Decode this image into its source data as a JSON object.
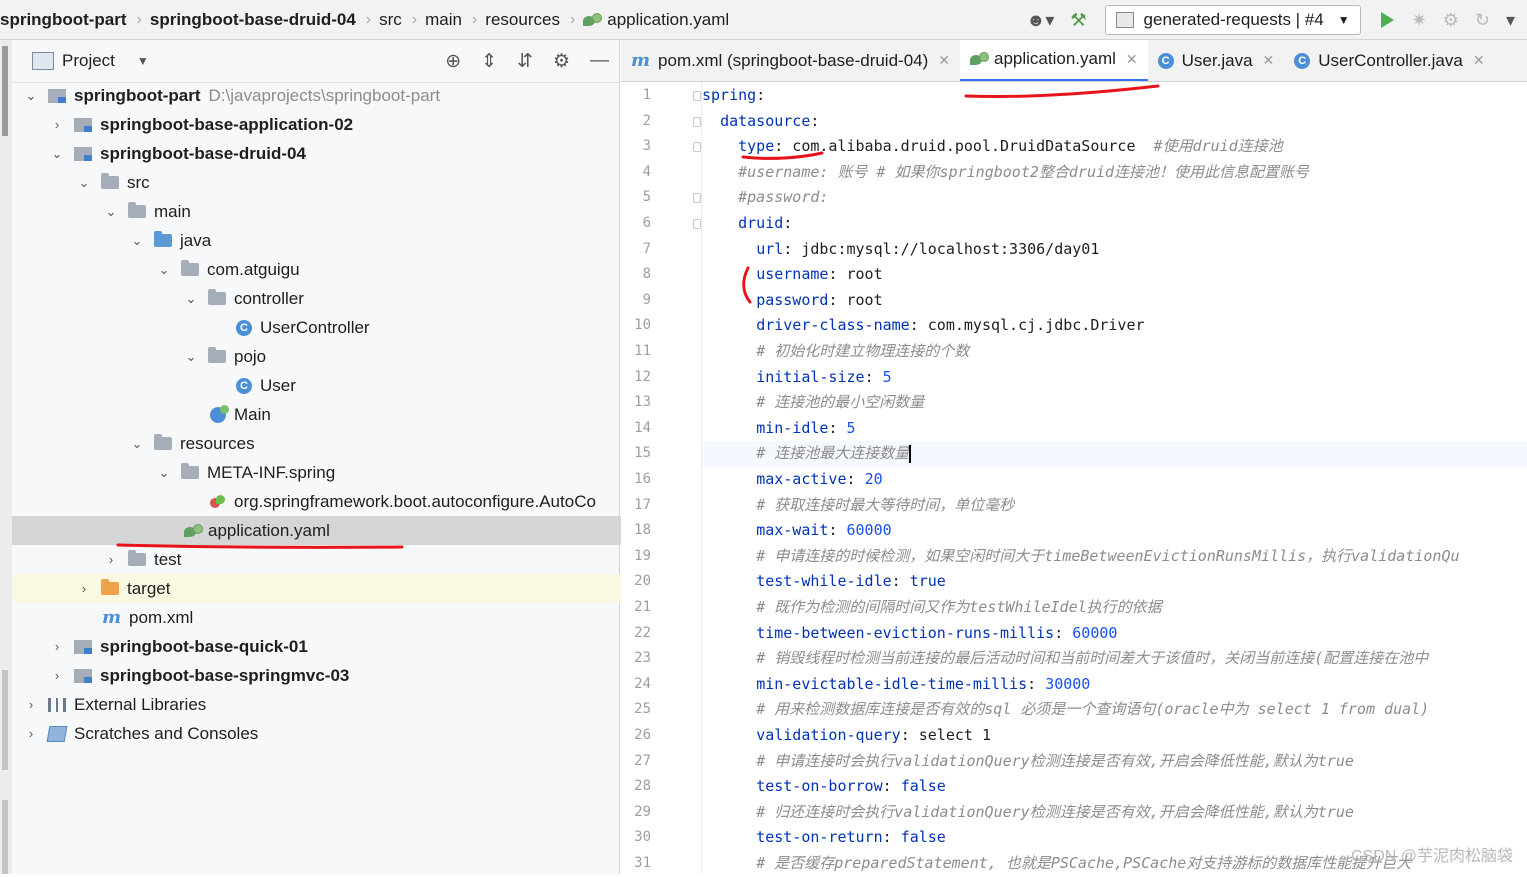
{
  "breadcrumb": [
    "springboot-part",
    "springboot-base-druid-04",
    "src",
    "main",
    "resources",
    "application.yaml"
  ],
  "run_config": {
    "label": "generated-requests | #4"
  },
  "project_panel": {
    "title": "Project",
    "tree": [
      {
        "label": "springboot-part",
        "hint": "D:\\javaprojects\\springboot-part",
        "icon": "module"
      },
      {
        "label": "springboot-base-application-02",
        "icon": "module"
      },
      {
        "label": "springboot-base-druid-04",
        "icon": "module"
      },
      {
        "label": "src",
        "icon": "folder"
      },
      {
        "label": "main",
        "icon": "folder"
      },
      {
        "label": "java",
        "icon": "folder-blue"
      },
      {
        "label": "com.atguigu",
        "icon": "package"
      },
      {
        "label": "controller",
        "icon": "package"
      },
      {
        "label": "UserController",
        "icon": "class"
      },
      {
        "label": "pojo",
        "icon": "package"
      },
      {
        "label": "User",
        "icon": "class"
      },
      {
        "label": "Main",
        "icon": "main-class"
      },
      {
        "label": "resources",
        "icon": "folder-resources"
      },
      {
        "label": "META-INF.spring",
        "icon": "folder"
      },
      {
        "label": "org.springframework.boot.autoconfigure.AutoCo",
        "icon": "spring-file"
      },
      {
        "label": "application.yaml",
        "icon": "yaml-file"
      },
      {
        "label": "test",
        "icon": "folder"
      },
      {
        "label": "target",
        "icon": "folder-orange"
      },
      {
        "label": "pom.xml",
        "icon": "maven-file"
      },
      {
        "label": "springboot-base-quick-01",
        "icon": "module"
      },
      {
        "label": "springboot-base-springmvc-03",
        "icon": "module"
      },
      {
        "label": "External Libraries",
        "icon": "libraries"
      },
      {
        "label": "Scratches and Consoles",
        "icon": "scratches"
      }
    ]
  },
  "tabs": [
    {
      "label": "pom.xml (springboot-base-druid-04)",
      "icon": "maven-icon",
      "active": false
    },
    {
      "label": "application.yaml",
      "icon": "yaml-icon",
      "active": true
    },
    {
      "label": "User.java",
      "icon": "class-icon",
      "active": false
    },
    {
      "label": "UserController.java",
      "icon": "class-icon",
      "active": false
    }
  ],
  "editor": {
    "current_line": 15,
    "lines": [
      {
        "n": "1",
        "parts": [
          [
            "key",
            "spring"
          ],
          [
            "plain",
            ":"
          ]
        ]
      },
      {
        "n": "2",
        "parts": [
          [
            "plain",
            "  "
          ],
          [
            "key",
            "datasource"
          ],
          [
            "plain",
            ":"
          ]
        ]
      },
      {
        "n": "3",
        "parts": [
          [
            "plain",
            "    "
          ],
          [
            "key",
            "type"
          ],
          [
            "plain",
            ": com.alibaba.druid.pool.DruidDataSource  "
          ],
          [
            "cmt",
            "#使用druid连接池"
          ]
        ]
      },
      {
        "n": "4",
        "parts": [
          [
            "plain",
            "    "
          ],
          [
            "cmt",
            "#username: 账号 # 如果你springboot2整合druid连接池！使用此信息配置账号"
          ]
        ]
      },
      {
        "n": "5",
        "parts": [
          [
            "plain",
            "    "
          ],
          [
            "cmt",
            "#password:"
          ]
        ]
      },
      {
        "n": "6",
        "parts": [
          [
            "plain",
            "    "
          ],
          [
            "key",
            "druid"
          ],
          [
            "plain",
            ":"
          ]
        ]
      },
      {
        "n": "7",
        "parts": [
          [
            "plain",
            "      "
          ],
          [
            "key",
            "url"
          ],
          [
            "plain",
            ": jdbc:mysql://localhost:3306/day01"
          ]
        ]
      },
      {
        "n": "8",
        "parts": [
          [
            "plain",
            "      "
          ],
          [
            "key",
            "username"
          ],
          [
            "plain",
            ": root"
          ]
        ]
      },
      {
        "n": "9",
        "parts": [
          [
            "plain",
            "      "
          ],
          [
            "key",
            "password"
          ],
          [
            "plain",
            ": root"
          ]
        ]
      },
      {
        "n": "10",
        "parts": [
          [
            "plain",
            "      "
          ],
          [
            "key",
            "driver-class-name"
          ],
          [
            "plain",
            ": com.mysql.cj.jdbc.Driver"
          ]
        ]
      },
      {
        "n": "11",
        "parts": [
          [
            "plain",
            "      "
          ],
          [
            "cmt",
            "# 初始化时建立物理连接的个数"
          ]
        ]
      },
      {
        "n": "12",
        "parts": [
          [
            "plain",
            "      "
          ],
          [
            "key",
            "initial-size"
          ],
          [
            "plain",
            ": "
          ],
          [
            "num",
            "5"
          ]
        ]
      },
      {
        "n": "13",
        "parts": [
          [
            "plain",
            "      "
          ],
          [
            "cmt",
            "# 连接池的最小空闲数量"
          ]
        ]
      },
      {
        "n": "14",
        "parts": [
          [
            "plain",
            "      "
          ],
          [
            "key",
            "min-idle"
          ],
          [
            "plain",
            ": "
          ],
          [
            "num",
            "5"
          ]
        ]
      },
      {
        "n": "15",
        "parts": [
          [
            "plain",
            "      "
          ],
          [
            "cmt",
            "# 连接池最大连接数量"
          ]
        ]
      },
      {
        "n": "16",
        "parts": [
          [
            "plain",
            "      "
          ],
          [
            "key",
            "max-active"
          ],
          [
            "plain",
            ": "
          ],
          [
            "num",
            "20"
          ]
        ]
      },
      {
        "n": "17",
        "parts": [
          [
            "plain",
            "      "
          ],
          [
            "cmt",
            "# 获取连接时最大等待时间，单位毫秒"
          ]
        ]
      },
      {
        "n": "18",
        "parts": [
          [
            "plain",
            "      "
          ],
          [
            "key",
            "max-wait"
          ],
          [
            "plain",
            ": "
          ],
          [
            "num",
            "60000"
          ]
        ]
      },
      {
        "n": "19",
        "parts": [
          [
            "plain",
            "      "
          ],
          [
            "cmt",
            "# 申请连接的时候检测，如果空闲时间大于timeBetweenEvictionRunsMillis，执行validationQu"
          ]
        ]
      },
      {
        "n": "20",
        "parts": [
          [
            "plain",
            "      "
          ],
          [
            "key",
            "test-while-idle"
          ],
          [
            "plain",
            ": "
          ],
          [
            "bool",
            "true"
          ]
        ]
      },
      {
        "n": "21",
        "parts": [
          [
            "plain",
            "      "
          ],
          [
            "cmt",
            "# 既作为检测的间隔时间又作为testWhileIdel执行的依据"
          ]
        ]
      },
      {
        "n": "22",
        "parts": [
          [
            "plain",
            "      "
          ],
          [
            "key",
            "time-between-eviction-runs-millis"
          ],
          [
            "plain",
            ": "
          ],
          [
            "num",
            "60000"
          ]
        ]
      },
      {
        "n": "23",
        "parts": [
          [
            "plain",
            "      "
          ],
          [
            "cmt",
            "# 销毁线程时检测当前连接的最后活动时间和当前时间差大于该值时，关闭当前连接(配置连接在池中"
          ]
        ]
      },
      {
        "n": "24",
        "parts": [
          [
            "plain",
            "      "
          ],
          [
            "key",
            "min-evictable-idle-time-millis"
          ],
          [
            "plain",
            ": "
          ],
          [
            "num",
            "30000"
          ]
        ]
      },
      {
        "n": "25",
        "parts": [
          [
            "plain",
            "      "
          ],
          [
            "cmt",
            "# 用来检测数据库连接是否有效的sql 必须是一个查询语句(oracle中为 select 1 from dual)"
          ]
        ]
      },
      {
        "n": "26",
        "parts": [
          [
            "plain",
            "      "
          ],
          [
            "key",
            "validation-query"
          ],
          [
            "plain",
            ": select 1"
          ]
        ]
      },
      {
        "n": "27",
        "parts": [
          [
            "plain",
            "      "
          ],
          [
            "cmt",
            "# 申请连接时会执行validationQuery检测连接是否有效,开启会降低性能,默认为true"
          ]
        ]
      },
      {
        "n": "28",
        "parts": [
          [
            "plain",
            "      "
          ],
          [
            "key",
            "test-on-borrow"
          ],
          [
            "plain",
            ": "
          ],
          [
            "bool",
            "false"
          ]
        ]
      },
      {
        "n": "29",
        "parts": [
          [
            "plain",
            "      "
          ],
          [
            "cmt",
            "# 归还连接时会执行validationQuery检测连接是否有效,开启会降低性能,默认为true"
          ]
        ]
      },
      {
        "n": "30",
        "parts": [
          [
            "plain",
            "      "
          ],
          [
            "key",
            "test-on-return"
          ],
          [
            "plain",
            ": "
          ],
          [
            "bool",
            "false"
          ]
        ]
      },
      {
        "n": "31",
        "parts": [
          [
            "plain",
            "      "
          ],
          [
            "cmt",
            "# 是否缓存preparedStatement, 也就是PSCache,PSCache对支持游标的数据库性能提升巨大"
          ]
        ]
      }
    ]
  },
  "watermark": "CSDN @芋泥肉松脑袋",
  "colors": {
    "annotation_red": "#e8141b",
    "active_tab_underline": "#3574f0",
    "keyword": "#0033b3",
    "number": "#1750eb",
    "comment": "#8c8c8c"
  }
}
